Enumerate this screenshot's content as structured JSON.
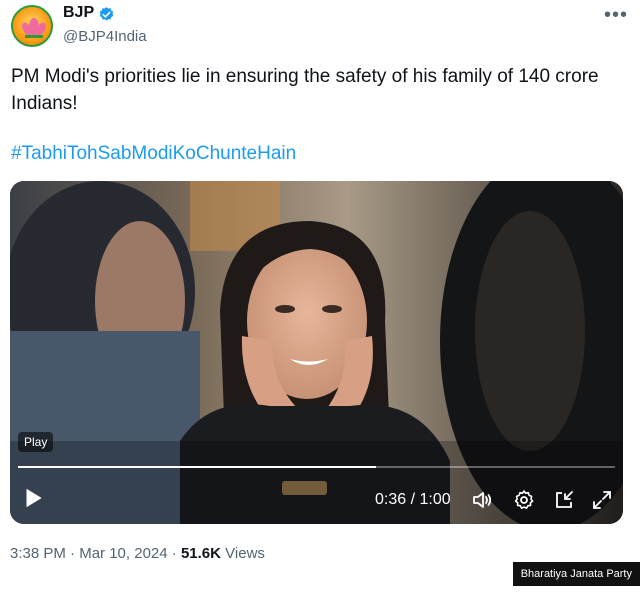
{
  "author": {
    "name": "BJP",
    "handle": "@BJP4India",
    "verified": true
  },
  "tweet": {
    "text": "PM Modi's priorities lie in ensuring the safety of his family of 140 crore Indians!",
    "hashtag": "#TabhiTohSabModiKoChunteHain"
  },
  "video": {
    "play_label": "Play",
    "time": "0:36 / 1:00",
    "progress_fraction": 0.6
  },
  "meta": {
    "time": "3:38 PM",
    "date": "Mar 10, 2024",
    "views_count": "51.6K",
    "views_label": "Views"
  },
  "watermark": "Bharatiya Janata Party",
  "colors": {
    "link": "#1d9bf0",
    "verified": "#1d9bf0",
    "secondary_text": "#536471",
    "primary_text": "#0f1419"
  },
  "icons": [
    "bjp-logo-icon",
    "verified-badge-icon",
    "more-options-icon",
    "play-icon",
    "volume-icon",
    "settings-icon",
    "picture-in-picture-icon",
    "fullscreen-icon"
  ]
}
